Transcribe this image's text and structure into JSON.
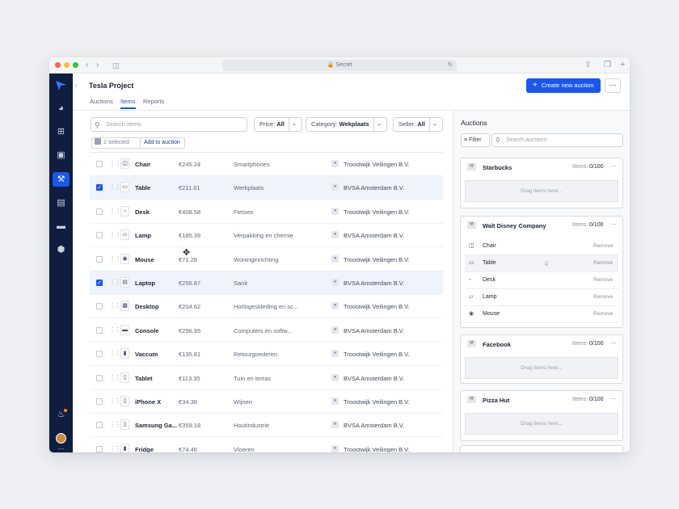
{
  "browser": {
    "url": "Secret"
  },
  "project": {
    "title": "Tesla Project"
  },
  "tabs": [
    {
      "label": "Auctions",
      "active": false
    },
    {
      "label": "Items",
      "active": true
    },
    {
      "label": "Reports",
      "active": false
    }
  ],
  "header": {
    "create_label": "Create new auction",
    "more_label": "⋯"
  },
  "toolbar": {
    "search_placeholder": "Search items",
    "price_label": "Price:",
    "price_value": "All",
    "category_label": "Category:",
    "category_value": "Wekplaats",
    "seller_label": "Seller:",
    "seller_value": "All"
  },
  "selection": {
    "count_text": "2 selected",
    "add_label": "Add to auction"
  },
  "items": [
    {
      "name": "Chair",
      "price": "€245.24",
      "category": "Smartphones",
      "seller": "Troostwijk Veilingen B.V.",
      "selected": false
    },
    {
      "name": "Table",
      "price": "€211.61",
      "category": "Werkplaats",
      "seller": "BVSA Amsterdam B.V.",
      "selected": true
    },
    {
      "name": "Desk",
      "price": "€408.58",
      "category": "Fietsen",
      "seller": "Troostwijk Veilingen B.V.",
      "selected": false
    },
    {
      "name": "Lamp",
      "price": "€185.39",
      "category": "Verpakking en chemie",
      "seller": "BVSA Amsterdam B.V.",
      "selected": false
    },
    {
      "name": "Mouse",
      "price": "€71.28",
      "category": "Woninginrichting",
      "seller": "Troostwijk Veilingen B.V.",
      "selected": false
    },
    {
      "name": "Laptop",
      "price": "€256.87",
      "category": "Sanit",
      "seller": "BVSA Amsterdam B.V.",
      "selected": true
    },
    {
      "name": "Desktop",
      "price": "€204.62",
      "category": "Horlogeskleding en sc...",
      "seller": "Troostwijk Veilingen B.V.",
      "selected": false
    },
    {
      "name": "Console",
      "price": "€296.95",
      "category": "Computers en softw...",
      "seller": "BVSA Amsterdam B.V.",
      "selected": false
    },
    {
      "name": "Vaccum",
      "price": "€135.81",
      "category": "Retourgoederen",
      "seller": "Troostwijk Veilingen B.V.",
      "selected": false
    },
    {
      "name": "Tablet",
      "price": "€113.35",
      "category": "Tuin en terras",
      "seller": "BVSA Amsterdam B.V.",
      "selected": false
    },
    {
      "name": "iPhone X",
      "price": "€34.38",
      "category": "Wijnen",
      "seller": "Troostwijk Veilingen B.V.",
      "selected": false
    },
    {
      "name": "Samsung Ga...",
      "price": "€359.18",
      "category": "Houtindustrie",
      "seller": "BVSA Amsterdam B.V.",
      "selected": false
    },
    {
      "name": "Fridge",
      "price": "€74.46",
      "category": "Vloeren",
      "seller": "Troostwijk Veilingen B.V.",
      "selected": false
    }
  ],
  "auctions_panel": {
    "title": "Auctions",
    "filter_label": "Filter",
    "search_placeholder": "Search auctions",
    "items_label": "Items:",
    "drag_text": "Drag items here...",
    "remove_label": "Remove",
    "cards": [
      {
        "name": "Starbucks",
        "count": "0/100"
      },
      {
        "name": "Walt Disney Company",
        "count": "0/100",
        "items": [
          "Chair",
          "Table",
          "Desk",
          "Lamp",
          "Mouse"
        ]
      },
      {
        "name": "Facebook",
        "count": "0/100"
      },
      {
        "name": "Pizza Hut",
        "count": "0/100"
      }
    ]
  },
  "colors": {
    "accent": "#1a56f0",
    "sidebar": "#0f1d3f",
    "selected_row": "#eef3fc"
  }
}
